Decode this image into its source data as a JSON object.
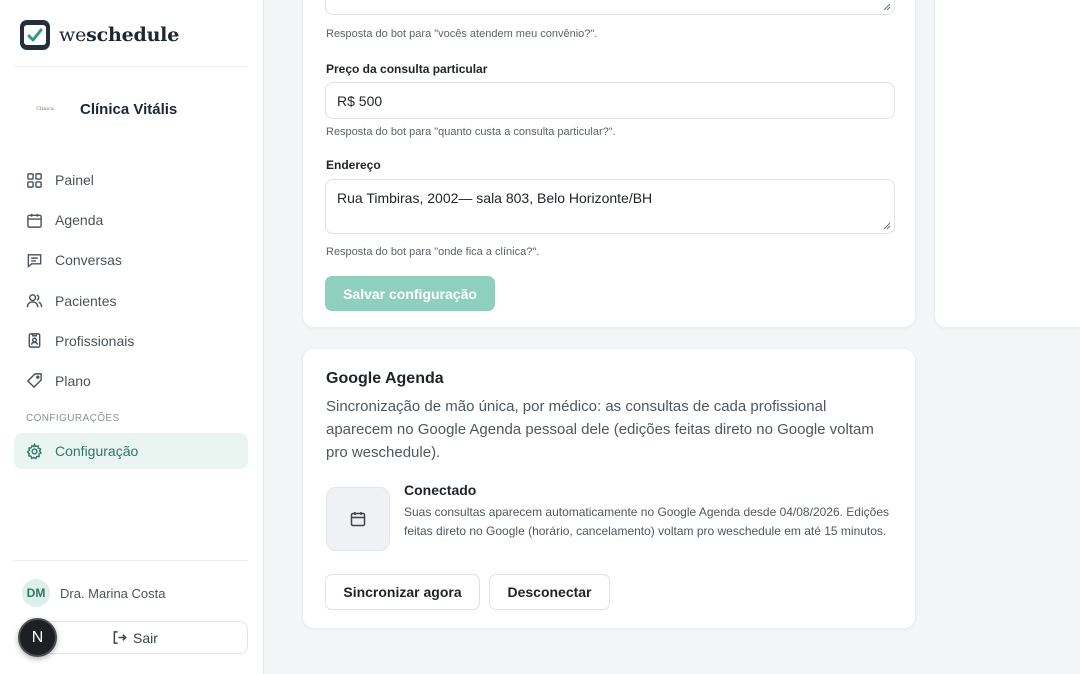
{
  "brand": {
    "prefix": "we",
    "suffix": "schedule"
  },
  "clinic": {
    "logo_text": "Clínica",
    "name": "Clínica Vitális"
  },
  "nav": {
    "items": [
      {
        "label": "Painel",
        "icon": "dashboard-icon"
      },
      {
        "label": "Agenda",
        "icon": "calendar-icon"
      },
      {
        "label": "Conversas",
        "icon": "chat-icon"
      },
      {
        "label": "Pacientes",
        "icon": "users-icon"
      },
      {
        "label": "Profissionais",
        "icon": "badge-icon"
      },
      {
        "label": "Plano",
        "icon": "tag-icon"
      }
    ],
    "section_label": "CONFIGURAÇÕES",
    "settings": {
      "label": "Configuração",
      "icon": "gear-icon"
    }
  },
  "user": {
    "initials": "DM",
    "name": "Dra. Marina Costa"
  },
  "logout_label": "Sair",
  "badge_letter": "N",
  "form": {
    "insurance_helper": "Resposta do bot para \"vocês atendem meu convênio?\".",
    "price": {
      "label": "Preço da consulta particular",
      "value": "R$ 500",
      "helper": "Resposta do bot para \"quanto custa a consulta particular?\"."
    },
    "address": {
      "label": "Endereço",
      "value": "Rua Timbiras, 2002— sala 803, Belo Horizonte/BH",
      "helper": "Resposta do bot para \"onde fica a clínica?\"."
    },
    "save_label": "Salvar configuração"
  },
  "google": {
    "title": "Google Agenda",
    "description": "Sincronização de mão única, por médico: as consultas de cada profissional aparecem no Google Agenda pessoal dele (edições feitas direto no Google voltam pro weschedule).",
    "status": "Conectado",
    "detail": "Suas consultas aparecem automaticamente no Google Agenda desde 04/08/2026. Edições feitas direto no Google (horário, cancelamento) voltam pro weschedule em até 15 minutos.",
    "sync_label": "Sincronizar agora",
    "disconnect_label": "Desconectar"
  },
  "colors": {
    "accent": "#2f7867",
    "accent_light": "#eaf4f1",
    "save_disabled": "#8fcfbd"
  }
}
